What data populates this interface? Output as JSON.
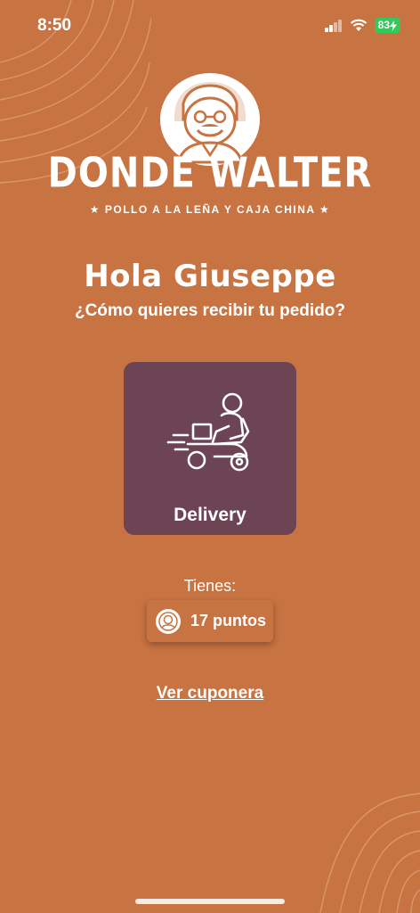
{
  "status_bar": {
    "time": "8:50",
    "battery": "83"
  },
  "brand": {
    "name": "DONDE WALTER",
    "tagline": "★ POLLO A LA LEÑA Y CAJA CHINA ★"
  },
  "greeting": "Hola Giuseppe",
  "question": "¿Cómo quieres recibir tu pedido?",
  "delivery_option": {
    "label": "Delivery",
    "icon": "delivery-scooter-icon"
  },
  "points": {
    "intro": "Tienes:",
    "label": "17 puntos",
    "value": 17
  },
  "links": {
    "cuponera": "Ver cuponera"
  },
  "colors": {
    "background": "#C87342",
    "card": "#6C4454",
    "text": "#FFFFFF"
  }
}
